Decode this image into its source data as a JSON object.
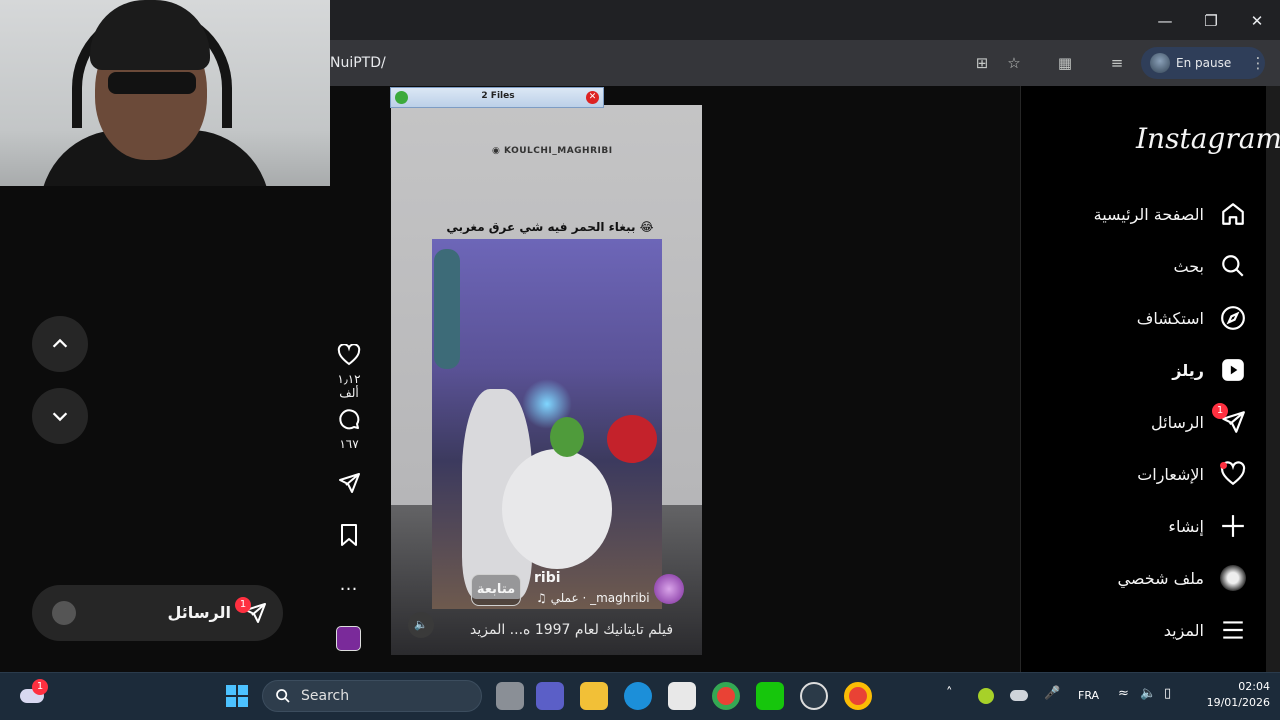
{
  "browser": {
    "url": "NuiPTD/",
    "profile_label": "En pause"
  },
  "popup": {
    "title": "2 Files"
  },
  "reel": {
    "handle": "KOULCHI_MAGHRIBI",
    "caption": "ببغاء الحمر فيه شي عرق مغربي 😂",
    "follow_label": "متابعة",
    "account": "ribi",
    "music": "♫ عملي · _maghribi",
    "description": "فيلم تايتانيك لعام 1997 ه... المزيد"
  },
  "actions": {
    "likes": "١٫١٢ ألف",
    "comments": "١٦٧"
  },
  "messages_pill": {
    "label": "الرسائل",
    "badge": "1"
  },
  "sidebar": {
    "logo": "Instagram",
    "items": [
      {
        "label": "الصفحة الرئيسية",
        "icon": "home-icon"
      },
      {
        "label": "بحث",
        "icon": "search-icon"
      },
      {
        "label": "استكشاف",
        "icon": "compass-icon"
      },
      {
        "label": "ريلز",
        "icon": "reels-icon"
      },
      {
        "label": "الرسائل",
        "icon": "messenger-icon",
        "badge": "1"
      },
      {
        "label": "الإشعارات",
        "icon": "heart-icon"
      },
      {
        "label": "إنشاء",
        "icon": "plus-icon"
      },
      {
        "label": "ملف شخصي",
        "icon": "profile-avatar-icon"
      },
      {
        "label": "المزيد",
        "icon": "menu-icon"
      }
    ]
  },
  "taskbar": {
    "weather_badge": "1",
    "search_placeholder": "Search",
    "language": "FRA",
    "time": "02:04",
    "date": "19/01/2026"
  }
}
